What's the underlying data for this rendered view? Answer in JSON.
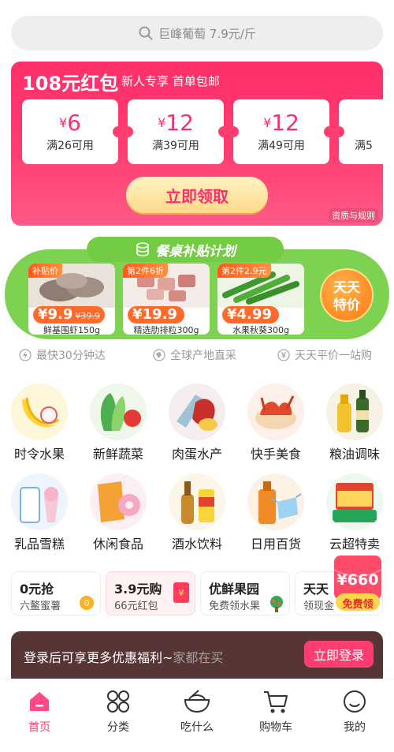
{
  "search": {
    "placeholder": "巨峰葡萄 7.9元/斤"
  },
  "banner": {
    "title": "108元红包",
    "subtitle": "新人专享  首单包邮",
    "coupons": [
      {
        "currency": "¥",
        "amount": "6",
        "condition": "满26可用"
      },
      {
        "currency": "¥",
        "amount": "12",
        "condition": "满39可用"
      },
      {
        "currency": "¥",
        "amount": "12",
        "condition": "满49可用"
      },
      {
        "currency": "",
        "amount": "",
        "condition": "满5"
      }
    ],
    "cta": "立即领取",
    "qualification": "资质与规则"
  },
  "subsidy": {
    "title": "餐桌补贴计划",
    "items": [
      {
        "tag": "补贴价",
        "price": "¥9.9",
        "original": "¥39.9",
        "name": "鲜基围虾150g"
      },
      {
        "tag": "第2件6折",
        "price": "¥19.9",
        "original": "",
        "name": "精选肋排粒300g"
      },
      {
        "tag": "第2件2.9元",
        "price": "¥4.99",
        "original": "",
        "name": "水果秋葵300g"
      }
    ],
    "badge_line1": "天天",
    "badge_line2": "特价"
  },
  "features": [
    {
      "icon": "lightning-icon",
      "label": "最快30分钟达"
    },
    {
      "icon": "globe-icon",
      "label": "全球产地直采"
    },
    {
      "icon": "yen-icon",
      "label": "天天平价一站购"
    }
  ],
  "categories": [
    {
      "label": "时令水果",
      "icon": "fruit-icon",
      "color": "#ffd43b"
    },
    {
      "label": "新鲜蔬菜",
      "icon": "vegetable-icon",
      "color": "#4caf50"
    },
    {
      "label": "肉蛋水产",
      "icon": "meat-icon",
      "color": "#e57373"
    },
    {
      "label": "快手美食",
      "icon": "quick-food-icon",
      "color": "#ff7043"
    },
    {
      "label": "粮油调味",
      "icon": "grain-oil-icon",
      "color": "#c8a24a"
    },
    {
      "label": "乳品雪糕",
      "icon": "dairy-icon",
      "color": "#90caf9"
    },
    {
      "label": "休闲食品",
      "icon": "snack-icon",
      "color": "#f48fb1"
    },
    {
      "label": "酒水饮料",
      "icon": "drink-icon",
      "color": "#ffb300"
    },
    {
      "label": "日用百货",
      "icon": "daily-goods-icon",
      "color": "#ff8a3d"
    },
    {
      "label": "云超特卖",
      "icon": "supermarket-icon",
      "color": "#26a65b"
    }
  ],
  "promos": [
    {
      "title": "0元抢",
      "sub": "六鳌蜜薯"
    },
    {
      "title": "3.9元购",
      "sub": "66元红包"
    },
    {
      "title": "优鲜果园",
      "sub": "免费领水果"
    },
    {
      "title": "天天",
      "sub": "领现金"
    }
  ],
  "float_coupon": {
    "amount": "¥660",
    "label": "免费领"
  },
  "login_bar": {
    "message": "登录后可享更多优惠福利~",
    "faded": "家都在买",
    "button": "立即登录"
  },
  "tabs": [
    {
      "label": "首页",
      "icon": "home-icon"
    },
    {
      "label": "分类",
      "icon": "category-icon"
    },
    {
      "label": "吃什么",
      "icon": "bowl-icon"
    },
    {
      "label": "购物车",
      "icon": "cart-icon"
    },
    {
      "label": "我的",
      "icon": "profile-icon"
    }
  ],
  "colors": {
    "brand": "#ff3d71",
    "green": "#7ed252",
    "orange": "#ff6a2a"
  }
}
